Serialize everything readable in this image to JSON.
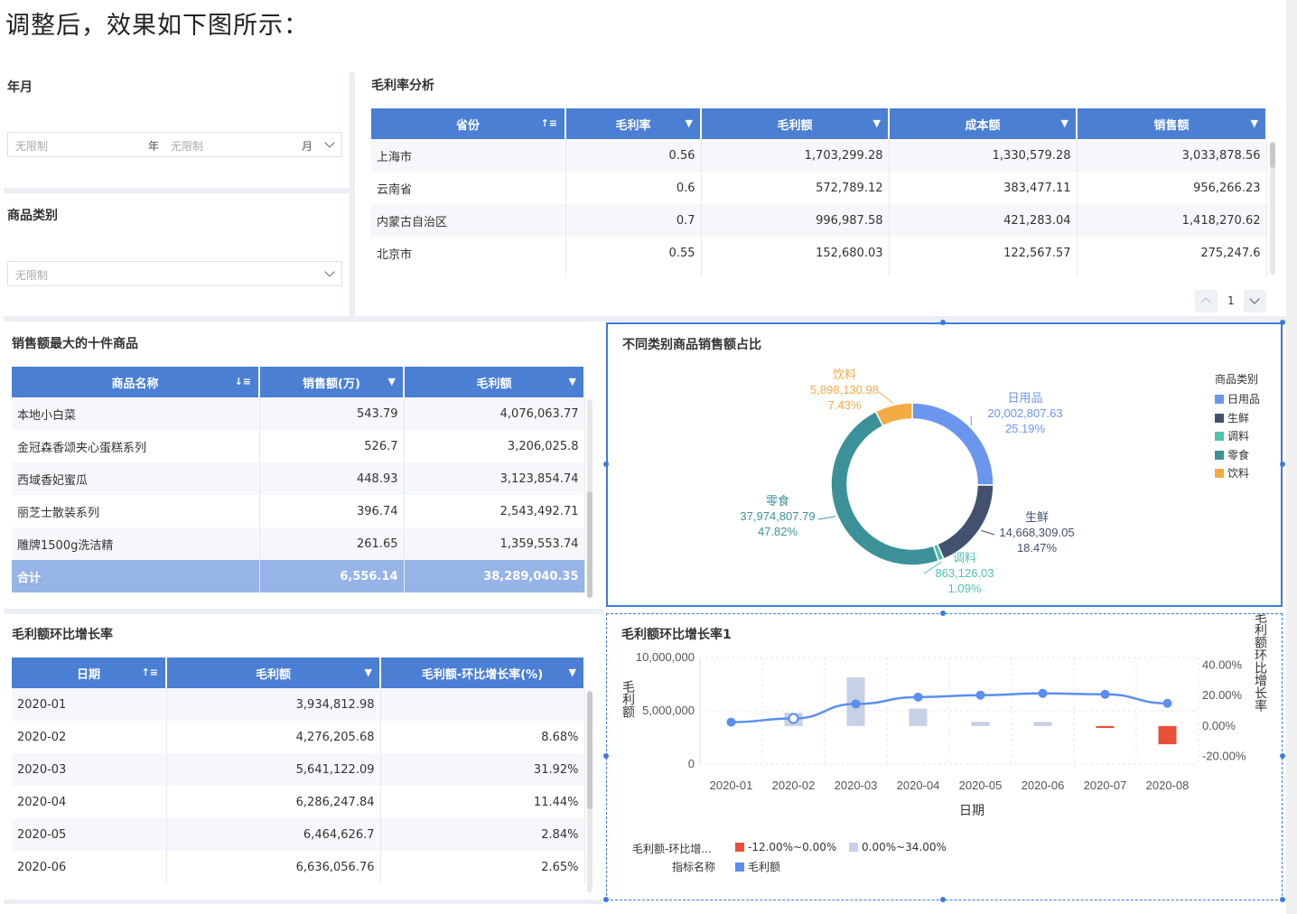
{
  "caption": "调整后，效果如下图所示：",
  "filters": {
    "yearmonth": {
      "title": "年月",
      "year_value": "无限制",
      "year_unit": "年",
      "month_value": "无限制",
      "month_unit": "月"
    },
    "category": {
      "title": "商品类别",
      "value": "无限制"
    }
  },
  "margin_table": {
    "title": "毛利率分析",
    "columns": [
      "省份",
      "毛利率",
      "毛利额",
      "成本额",
      "销售额"
    ],
    "rows": [
      [
        "上海市",
        "0.56",
        "1,703,299.28",
        "1,330,579.28",
        "3,033,878.56"
      ],
      [
        "云南省",
        "0.6",
        "572,789.12",
        "383,477.11",
        "956,266.23"
      ],
      [
        "内蒙古自治区",
        "0.7",
        "996,987.58",
        "421,283.04",
        "1,418,270.62"
      ],
      [
        "北京市",
        "0.55",
        "152,680.03",
        "122,567.57",
        "275,247.6"
      ]
    ],
    "page": "1"
  },
  "top10_table": {
    "title": "销售额最大的十件商品",
    "columns": [
      "商品名称",
      "销售额(万)",
      "毛利额"
    ],
    "rows": [
      [
        "本地小白菜",
        "543.79",
        "4,076,063.77"
      ],
      [
        "金冠森香颂夹心蛋糕系列",
        "526.7",
        "3,206,025.8"
      ],
      [
        "西域香妃蜜瓜",
        "448.93",
        "3,123,854.74"
      ],
      [
        "丽芝士散装系列",
        "396.74",
        "2,543,492.71"
      ],
      [
        "雕牌1500g洗洁精",
        "261.65",
        "1,359,553.74"
      ]
    ],
    "total": [
      "合计",
      "6,556.14",
      "38,289,040.35"
    ]
  },
  "growth_table": {
    "title": "毛利额环比增长率",
    "columns": [
      "日期",
      "毛利额",
      "毛利额-环比增长率(%)"
    ],
    "rows": [
      [
        "2020-01",
        "3,934,812.98",
        ""
      ],
      [
        "2020-02",
        "4,276,205.68",
        "8.68%"
      ],
      [
        "2020-03",
        "5,641,122.09",
        "31.92%"
      ],
      [
        "2020-04",
        "6,286,247.84",
        "11.44%"
      ],
      [
        "2020-05",
        "6,464,626.7",
        "2.84%"
      ],
      [
        "2020-06",
        "6,636,056.76",
        "2.65%"
      ]
    ]
  },
  "donut_panel": {
    "title": "不同类别商品销售额占比",
    "legend_title": "商品类别"
  },
  "combo_panel": {
    "title": "毛利额环比增长率1",
    "ylabel_left": "毛利额",
    "ylabel_right": "毛利额环比增长率",
    "xlabel": "日期",
    "legend_row1_label": "毛利额-环比增...",
    "legend_row2_label": "指标名称",
    "legend_neg": "-12.00%~0.00%",
    "legend_pos": "0.00%~34.00%",
    "legend_line": "毛利额"
  },
  "chart_data": [
    {
      "type": "pie",
      "title": "不同类别商品销售额占比",
      "donut": true,
      "legend_title": "商品类别",
      "legend_position": "right",
      "slices": [
        {
          "name": "日用品",
          "value": 20002807.63,
          "value_label": "20,002,807.63",
          "percent": "25.19%",
          "color": "#6b96ee"
        },
        {
          "name": "生鲜",
          "value": 14668309.05,
          "value_label": "14,668,309.05",
          "percent": "18.47%",
          "color": "#42526e"
        },
        {
          "name": "调料",
          "value": 863126.03,
          "value_label": "863,126.03",
          "percent": "1.09%",
          "color": "#4ec3b1"
        },
        {
          "name": "零食",
          "value": 37974807.79,
          "value_label": "37,974,807.79",
          "percent": "47.82%",
          "color": "#3c9199"
        },
        {
          "name": "饮料",
          "value": 5898130.98,
          "value_label": "5,898,130.98",
          "percent": "7.43%",
          "color": "#f5ab44"
        }
      ]
    },
    {
      "type": "bar",
      "title": "毛利额环比增长率1",
      "xlabel": "日期",
      "ylabel": "毛利额",
      "y2label": "毛利额环比增长率",
      "categories": [
        "2020-01",
        "2020-02",
        "2020-03",
        "2020-04",
        "2020-05",
        "2020-06",
        "2020-07",
        "2020-08"
      ],
      "ylim": [
        0,
        10000000
      ],
      "yticks": [
        "10,000,000",
        "5,000,000",
        "0"
      ],
      "y2lim": [
        -25,
        45
      ],
      "y2ticks": [
        "40.00%",
        "20.00%",
        "0.00%",
        "-20.00%"
      ],
      "series": [
        {
          "name": "毛利额",
          "kind": "line",
          "axis": "left",
          "color": "#5b8ef0",
          "values": [
            3934812.98,
            4276205.68,
            5641122.09,
            6286247.84,
            6464626.7,
            6636056.76,
            6550000,
            5700000
          ]
        },
        {
          "name": "毛利额-环比增长率",
          "kind": "bar",
          "axis": "right",
          "values": [
            null,
            8.68,
            31.92,
            11.44,
            2.84,
            2.65,
            -1.3,
            -12
          ]
        }
      ],
      "legend": [
        {
          "label": "-12.00%~0.00%",
          "color": "#e8503a"
        },
        {
          "label": "0.00%~34.00%",
          "color": "#c6d0e6"
        }
      ],
      "grid": true
    }
  ]
}
